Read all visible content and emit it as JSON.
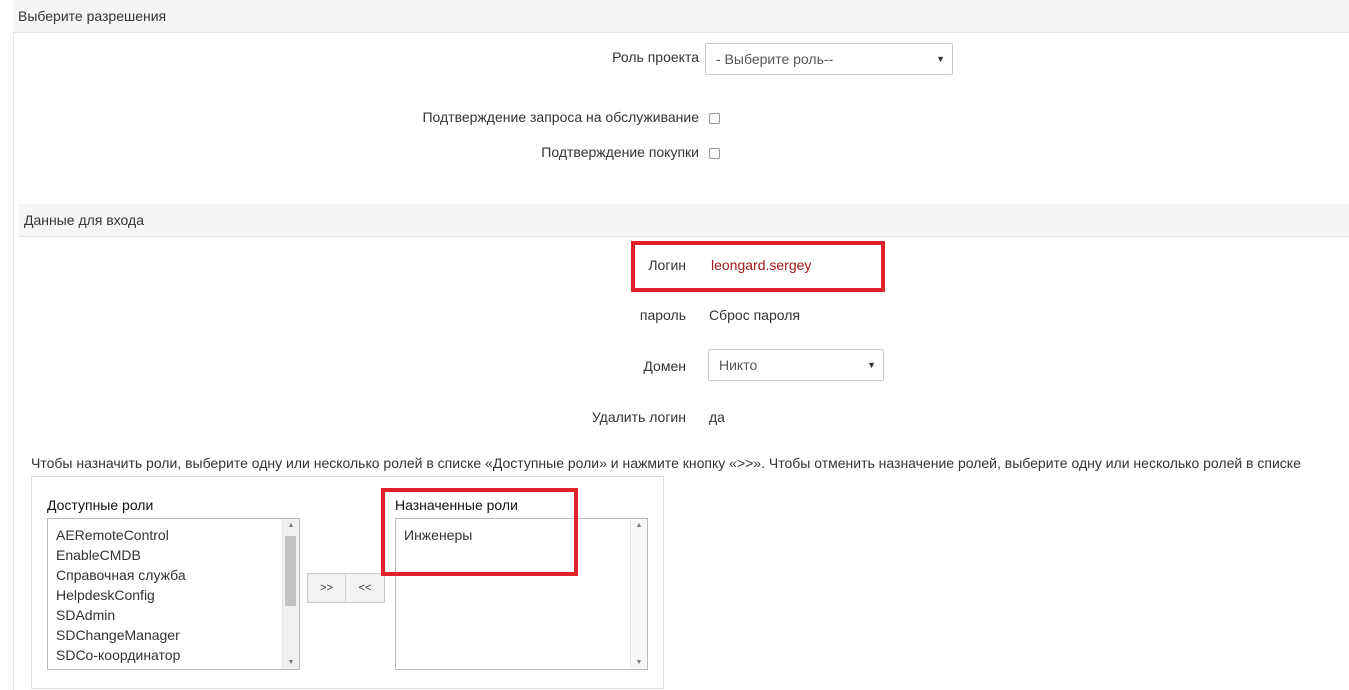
{
  "permissions": {
    "header": "Выберите разрешения",
    "project_role_label": "Роль проекта",
    "project_role_value": "- Выберите роль--",
    "service_request_label": "Подтверждение запроса на обслуживание",
    "purchase_label": "Подтверждение покупки"
  },
  "login_data": {
    "header": "Данные для входа",
    "login_label": "Логин",
    "login_value": "leongard.sergey",
    "password_label": "пароль",
    "password_value": "Сброс пароля",
    "domain_label": "Домен",
    "domain_value": "Никто",
    "delete_login_label": "Удалить логин",
    "delete_login_value": "да"
  },
  "roles": {
    "instructions": "Чтобы назначить роли, выберите одну или несколько ролей в списке «Доступные роли» и нажмите кнопку «>>». Чтобы отменить назначение ролей, выберите одну или несколько ролей в списке",
    "available_label": "Доступные роли",
    "assigned_label": "Назначенные роли",
    "available": [
      "AERemoteControl",
      "EnableCMDB",
      "Справочная служба",
      "HelpdeskConfig",
      "SDAdmin",
      "SDChangeManager",
      "SDCo-координатор"
    ],
    "assigned": [
      "Инженеры"
    ],
    "add_button": ">>",
    "remove_button": "<<"
  },
  "colors": {
    "highlight": "#e0202a",
    "login_value": "#a01818"
  }
}
